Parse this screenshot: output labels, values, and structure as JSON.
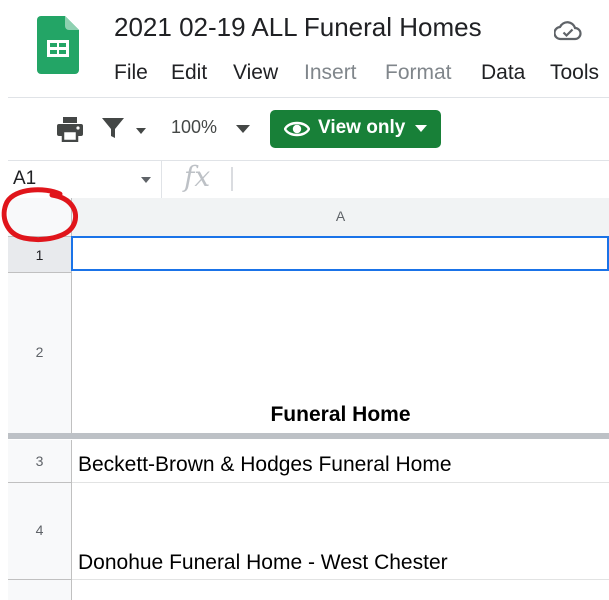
{
  "header": {
    "title": "2021 02-19 ALL Funeral Homes",
    "menu": [
      {
        "label": "File",
        "disabled": false
      },
      {
        "label": "Edit",
        "disabled": false
      },
      {
        "label": "View",
        "disabled": false
      },
      {
        "label": "Insert",
        "disabled": true
      },
      {
        "label": "Format",
        "disabled": true
      },
      {
        "label": "Data",
        "disabled": false
      },
      {
        "label": "Tools",
        "disabled": false
      }
    ],
    "icons": {
      "logo": "google-sheets-logo",
      "status": "cloud-check-icon"
    }
  },
  "toolbar": {
    "zoom": "100%",
    "view_only_label": "View only",
    "icons": [
      "print-icon",
      "filter-icon",
      "eye-icon"
    ]
  },
  "formula_bar": {
    "name_box": "A1",
    "fx_label": "fx"
  },
  "grid": {
    "column_header": "A",
    "rows": [
      {
        "number": "1",
        "value": ""
      },
      {
        "number": "2",
        "value": "Funeral Home"
      },
      {
        "number": "3",
        "value": "Beckett-Brown & Hodges Funeral Home"
      },
      {
        "number": "4",
        "value": "Donohue Funeral Home - West Chester"
      }
    ],
    "selected_cell": "A1"
  },
  "colors": {
    "accent_green": "#188038",
    "selection_blue": "#1a73e8",
    "annotation_red": "#e0151b",
    "sheets_green": "#23a566"
  }
}
